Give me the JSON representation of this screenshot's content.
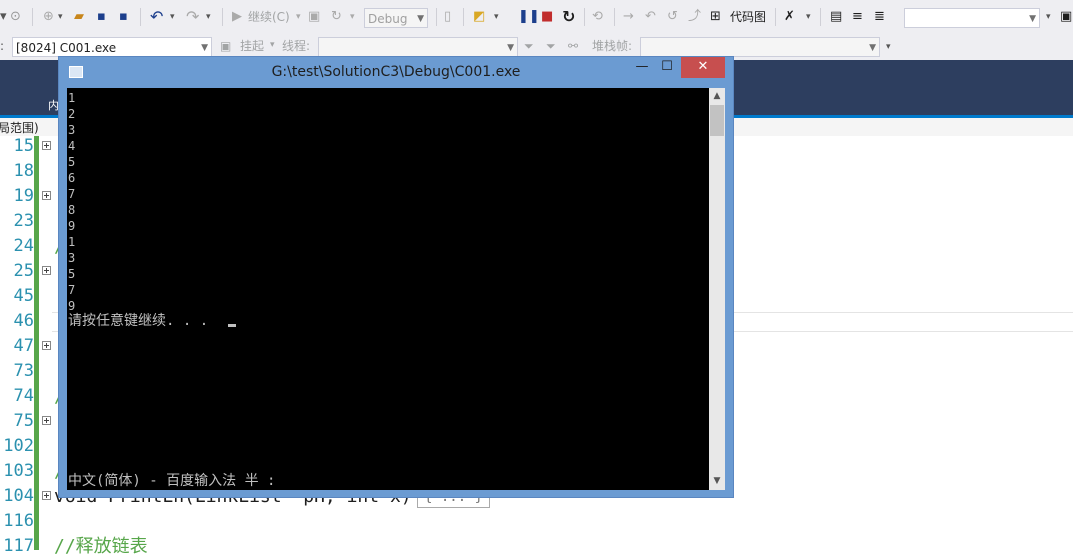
{
  "toolbar": {
    "continue_label": "继续(C)",
    "config_value": "Debug",
    "codemap_label": "代码图"
  },
  "debugbar": {
    "process_value": "[8024] C001.exe",
    "suspend_label": "挂起",
    "thread_label": "线程:",
    "stackframe_label": "堆栈帧:"
  },
  "tabs": {
    "fragment": "内"
  },
  "scope": {
    "text": "局范围)"
  },
  "editor": {
    "line_numbers": [
      "15",
      "18",
      "19",
      "23",
      "24",
      "25",
      "45",
      "46",
      "47",
      "73",
      "74",
      "75",
      "102",
      "103",
      "104",
      "116",
      "117"
    ],
    "code": {
      "line104": "void PrintLn(LinkList *pH, int x)",
      "line104_collapsed": "{ ... }",
      "line117": "//释放链表",
      "slash": "/"
    }
  },
  "console": {
    "title": "G:\\test\\SolutionC3\\Debug\\C001.exe",
    "output_lines": [
      "1",
      "2",
      "3",
      "4",
      "5",
      "6",
      "7",
      "8",
      "9",
      "1",
      "3",
      "5",
      "7",
      "9"
    ],
    "prompt": "请按任意键继续. . .",
    "ime_status": "中文(简体) - 百度输入法 半 :",
    "minimize_glyph": "—",
    "maximize_glyph": "☐",
    "close_glyph": "✕"
  },
  "colors": {
    "console_frame": "#6b9bd2",
    "console_bg": "#000000",
    "tab_strip": "#2d3e5f",
    "accent": "#007acc",
    "line_number": "#2b91af",
    "comment": "#57a64a",
    "change_bar": "#57a64a"
  }
}
